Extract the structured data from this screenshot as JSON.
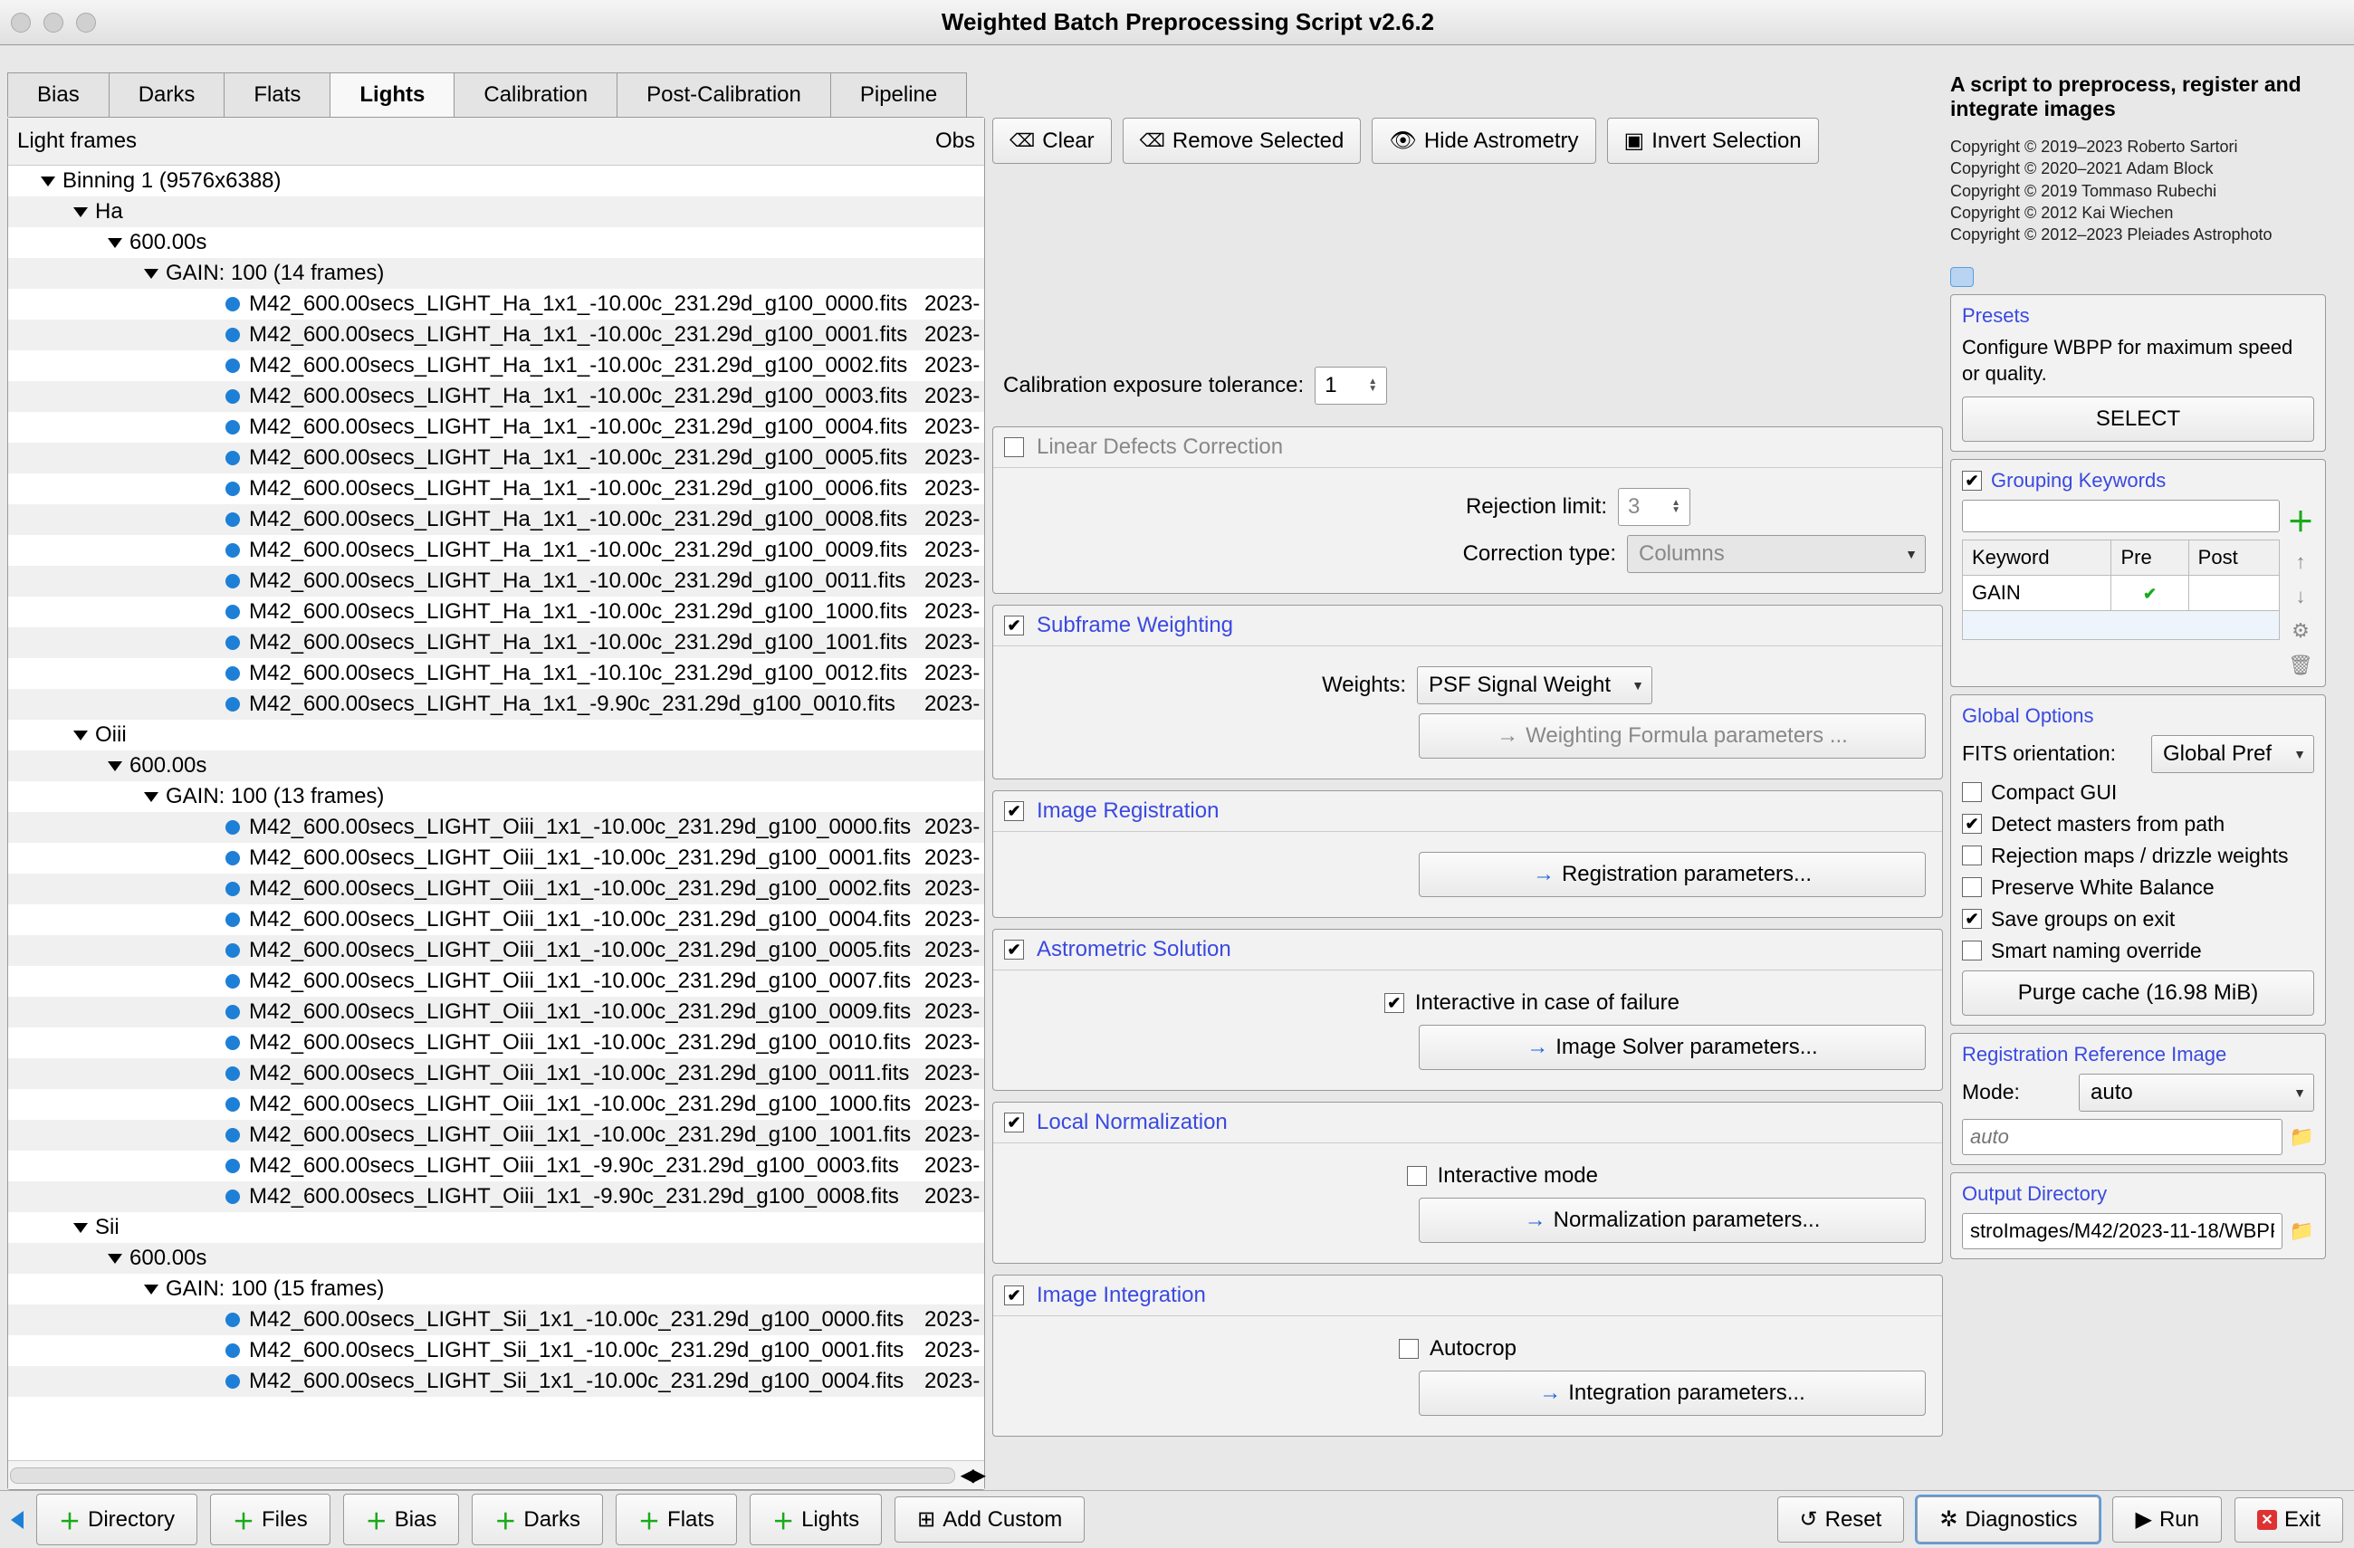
{
  "window": {
    "title": "Weighted Batch Preprocessing Script v2.6.2"
  },
  "tabs": [
    "Bias",
    "Darks",
    "Flats",
    "Lights",
    "Calibration",
    "Post-Calibration",
    "Pipeline"
  ],
  "active_tab": "Lights",
  "tree_header": {
    "main": "Light frames",
    "obs": "Obs"
  },
  "tree": [
    {
      "type": "group",
      "indent": 0,
      "label": "Binning 1 (9576x6388)"
    },
    {
      "type": "group",
      "indent": 1,
      "label": "Ha"
    },
    {
      "type": "group",
      "indent": 2,
      "label": "600.00s"
    },
    {
      "type": "group",
      "indent": 3,
      "label": "GAIN: 100 (14 frames)"
    },
    {
      "type": "file",
      "indent": 4,
      "label": "M42_600.00secs_LIGHT_Ha_1x1_-10.00c_231.29d_g100_0000.fits",
      "date": "2023-"
    },
    {
      "type": "file",
      "indent": 4,
      "label": "M42_600.00secs_LIGHT_Ha_1x1_-10.00c_231.29d_g100_0001.fits",
      "date": "2023-"
    },
    {
      "type": "file",
      "indent": 4,
      "label": "M42_600.00secs_LIGHT_Ha_1x1_-10.00c_231.29d_g100_0002.fits",
      "date": "2023-"
    },
    {
      "type": "file",
      "indent": 4,
      "label": "M42_600.00secs_LIGHT_Ha_1x1_-10.00c_231.29d_g100_0003.fits",
      "date": "2023-"
    },
    {
      "type": "file",
      "indent": 4,
      "label": "M42_600.00secs_LIGHT_Ha_1x1_-10.00c_231.29d_g100_0004.fits",
      "date": "2023-"
    },
    {
      "type": "file",
      "indent": 4,
      "label": "M42_600.00secs_LIGHT_Ha_1x1_-10.00c_231.29d_g100_0005.fits",
      "date": "2023-"
    },
    {
      "type": "file",
      "indent": 4,
      "label": "M42_600.00secs_LIGHT_Ha_1x1_-10.00c_231.29d_g100_0006.fits",
      "date": "2023-"
    },
    {
      "type": "file",
      "indent": 4,
      "label": "M42_600.00secs_LIGHT_Ha_1x1_-10.00c_231.29d_g100_0008.fits",
      "date": "2023-"
    },
    {
      "type": "file",
      "indent": 4,
      "label": "M42_600.00secs_LIGHT_Ha_1x1_-10.00c_231.29d_g100_0009.fits",
      "date": "2023-"
    },
    {
      "type": "file",
      "indent": 4,
      "label": "M42_600.00secs_LIGHT_Ha_1x1_-10.00c_231.29d_g100_0011.fits",
      "date": "2023-"
    },
    {
      "type": "file",
      "indent": 4,
      "label": "M42_600.00secs_LIGHT_Ha_1x1_-10.00c_231.29d_g100_1000.fits",
      "date": "2023-"
    },
    {
      "type": "file",
      "indent": 4,
      "label": "M42_600.00secs_LIGHT_Ha_1x1_-10.00c_231.29d_g100_1001.fits",
      "date": "2023-"
    },
    {
      "type": "file",
      "indent": 4,
      "label": "M42_600.00secs_LIGHT_Ha_1x1_-10.10c_231.29d_g100_0012.fits",
      "date": "2023-"
    },
    {
      "type": "file",
      "indent": 4,
      "label": "M42_600.00secs_LIGHT_Ha_1x1_-9.90c_231.29d_g100_0010.fits",
      "date": "2023-"
    },
    {
      "type": "group",
      "indent": 1,
      "label": "Oiii"
    },
    {
      "type": "group",
      "indent": 2,
      "label": "600.00s"
    },
    {
      "type": "group",
      "indent": 3,
      "label": "GAIN: 100 (13 frames)"
    },
    {
      "type": "file",
      "indent": 4,
      "label": "M42_600.00secs_LIGHT_Oiii_1x1_-10.00c_231.29d_g100_0000.fits",
      "date": "2023-"
    },
    {
      "type": "file",
      "indent": 4,
      "label": "M42_600.00secs_LIGHT_Oiii_1x1_-10.00c_231.29d_g100_0001.fits",
      "date": "2023-"
    },
    {
      "type": "file",
      "indent": 4,
      "label": "M42_600.00secs_LIGHT_Oiii_1x1_-10.00c_231.29d_g100_0002.fits",
      "date": "2023-"
    },
    {
      "type": "file",
      "indent": 4,
      "label": "M42_600.00secs_LIGHT_Oiii_1x1_-10.00c_231.29d_g100_0004.fits",
      "date": "2023-"
    },
    {
      "type": "file",
      "indent": 4,
      "label": "M42_600.00secs_LIGHT_Oiii_1x1_-10.00c_231.29d_g100_0005.fits",
      "date": "2023-"
    },
    {
      "type": "file",
      "indent": 4,
      "label": "M42_600.00secs_LIGHT_Oiii_1x1_-10.00c_231.29d_g100_0007.fits",
      "date": "2023-"
    },
    {
      "type": "file",
      "indent": 4,
      "label": "M42_600.00secs_LIGHT_Oiii_1x1_-10.00c_231.29d_g100_0009.fits",
      "date": "2023-"
    },
    {
      "type": "file",
      "indent": 4,
      "label": "M42_600.00secs_LIGHT_Oiii_1x1_-10.00c_231.29d_g100_0010.fits",
      "date": "2023-"
    },
    {
      "type": "file",
      "indent": 4,
      "label": "M42_600.00secs_LIGHT_Oiii_1x1_-10.00c_231.29d_g100_0011.fits",
      "date": "2023-"
    },
    {
      "type": "file",
      "indent": 4,
      "label": "M42_600.00secs_LIGHT_Oiii_1x1_-10.00c_231.29d_g100_1000.fits",
      "date": "2023-"
    },
    {
      "type": "file",
      "indent": 4,
      "label": "M42_600.00secs_LIGHT_Oiii_1x1_-10.00c_231.29d_g100_1001.fits",
      "date": "2023-"
    },
    {
      "type": "file",
      "indent": 4,
      "label": "M42_600.00secs_LIGHT_Oiii_1x1_-9.90c_231.29d_g100_0003.fits",
      "date": "2023-"
    },
    {
      "type": "file",
      "indent": 4,
      "label": "M42_600.00secs_LIGHT_Oiii_1x1_-9.90c_231.29d_g100_0008.fits",
      "date": "2023-"
    },
    {
      "type": "group",
      "indent": 1,
      "label": "Sii"
    },
    {
      "type": "group",
      "indent": 2,
      "label": "600.00s"
    },
    {
      "type": "group",
      "indent": 3,
      "label": "GAIN: 100 (15 frames)"
    },
    {
      "type": "file",
      "indent": 4,
      "label": "M42_600.00secs_LIGHT_Sii_1x1_-10.00c_231.29d_g100_0000.fits",
      "date": "2023-"
    },
    {
      "type": "file",
      "indent": 4,
      "label": "M42_600.00secs_LIGHT_Sii_1x1_-10.00c_231.29d_g100_0001.fits",
      "date": "2023-"
    },
    {
      "type": "file",
      "indent": 4,
      "label": "M42_600.00secs_LIGHT_Sii_1x1_-10.00c_231.29d_g100_0004.fits",
      "date": "2023-"
    }
  ],
  "toolbar": {
    "clear": "Clear",
    "remove": "Remove Selected",
    "hide": "Hide Astrometry",
    "invert": "Invert Selection"
  },
  "calibration": {
    "tolerance_label": "Calibration exposure tolerance:",
    "tolerance_value": "1"
  },
  "panels": {
    "linear_defects": {
      "title": "Linear Defects Correction",
      "rejection_label": "Rejection limit:",
      "rejection_value": "3",
      "correction_label": "Correction type:",
      "correction_value": "Columns"
    },
    "subframe": {
      "title": "Subframe Weighting",
      "weights_label": "Weights:",
      "weights_value": "PSF Signal Weight",
      "formula_btn": "Weighting Formula parameters ..."
    },
    "registration": {
      "title": "Image Registration",
      "btn": "Registration parameters..."
    },
    "astrometric": {
      "title": "Astrometric Solution",
      "interactive": "Interactive in case of failure",
      "btn": "Image Solver parameters..."
    },
    "local_norm": {
      "title": "Local Normalization",
      "interactive": "Interactive mode",
      "btn": "Normalization parameters..."
    },
    "integration": {
      "title": "Image Integration",
      "autocrop": "Autocrop",
      "btn": "Integration parameters..."
    }
  },
  "right": {
    "desc": "A script to preprocess, register and integrate images",
    "copyrights": [
      "Copyright © 2019–2023 Roberto Sartori",
      "Copyright © 2020–2021 Adam Block",
      "Copyright © 2019 Tommaso Rubechi",
      "Copyright © 2012 Kai Wiechen",
      "Copyright © 2012–2023 Pleiades Astrophoto"
    ],
    "presets": {
      "title": "Presets",
      "desc": "Configure WBPP for maximum speed or quality.",
      "btn": "SELECT"
    },
    "grouping": {
      "title": "Grouping Keywords",
      "th_keyword": "Keyword",
      "th_pre": "Pre",
      "th_post": "Post",
      "row_keyword": "GAIN"
    },
    "global": {
      "title": "Global Options",
      "fits_label": "FITS orientation:",
      "fits_value": "Global Pref",
      "compact": "Compact GUI",
      "detect": "Detect masters from path",
      "rejection": "Rejection maps / drizzle weights",
      "preserve": "Preserve White Balance",
      "save": "Save groups on exit",
      "smart": "Smart naming override",
      "purge": "Purge cache (16.98 MiB)"
    },
    "regref": {
      "title": "Registration Reference Image",
      "mode_label": "Mode:",
      "mode_value": "auto",
      "path_placeholder": "auto"
    },
    "outdir": {
      "title": "Output Directory",
      "path": "stroImages/M42/2023-11-18/WBPP"
    }
  },
  "bottom": {
    "directory": "Directory",
    "files": "Files",
    "bias": "Bias",
    "darks": "Darks",
    "flats": "Flats",
    "lights": "Lights",
    "add_custom": "Add Custom",
    "reset": "Reset",
    "diagnostics": "Diagnostics",
    "run": "Run",
    "exit": "Exit"
  }
}
